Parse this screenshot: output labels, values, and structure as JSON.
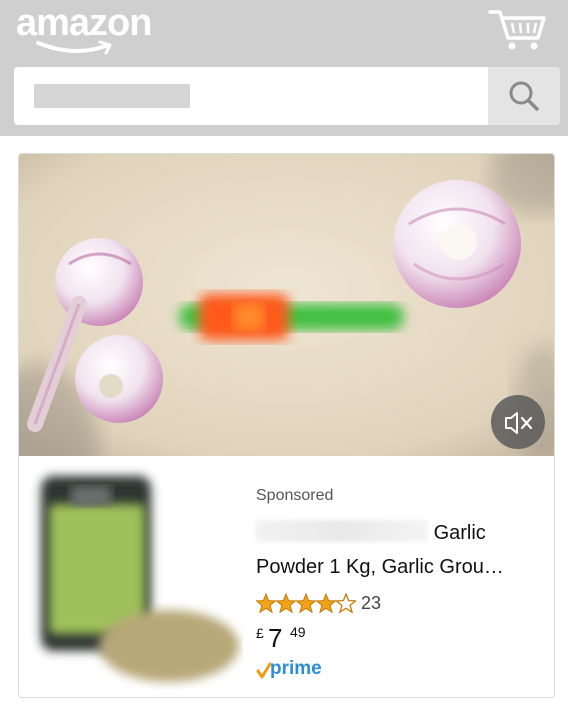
{
  "header": {
    "logo_text": "amazon",
    "background": "#cfcfcf",
    "cart_icon": "cart-icon"
  },
  "search": {
    "placeholder": "",
    "value": "",
    "button_icon": "search-icon"
  },
  "ad": {
    "video": {
      "mute_icon": "mute-icon"
    },
    "product": {
      "sponsored_label": "Sponsored",
      "title_suffix": "Garlic",
      "title_line2": "Powder 1 Kg, Garlic Grou…",
      "rating": 4,
      "rating_max": 5,
      "rating_count": "23",
      "price_currency": "£",
      "price_whole": "7",
      "price_fraction": "49",
      "prime_label": "prime",
      "prime_color": "#2c8fd6",
      "star_color": "#f0a21a"
    }
  }
}
